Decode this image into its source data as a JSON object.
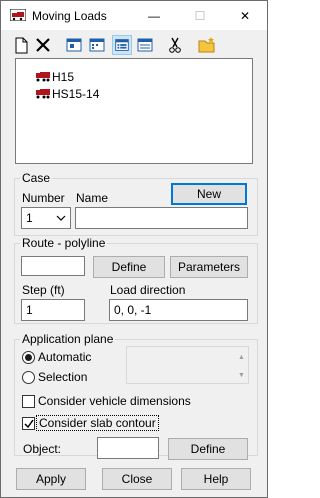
{
  "window": {
    "title": "Moving Loads"
  },
  "titlebar_buttons": {
    "minimize": "—",
    "maximize": "☐",
    "close": "✕"
  },
  "loads": [
    {
      "label": "H15"
    },
    {
      "label": "HS15-14"
    }
  ],
  "case": {
    "group_label": "Case",
    "number_label": "Number",
    "name_label": "Name",
    "new_button": "New",
    "number_value": "1",
    "name_value": ""
  },
  "route": {
    "group_label": "Route - polyline",
    "value": "",
    "define_button": "Define",
    "parameters_button": "Parameters",
    "step_label": "Step (ft)",
    "step_value": "1",
    "direction_label": "Load direction",
    "direction_value": "0, 0, -1"
  },
  "application": {
    "group_label": "Application plane",
    "automatic_label": "Automatic",
    "selection_label": "Selection",
    "selected": "automatic"
  },
  "options": {
    "vehicle_dims_label": "Consider vehicle dimensions",
    "vehicle_dims_checked": false,
    "slab_contour_label": "Consider slab contour",
    "slab_contour_checked": true
  },
  "object": {
    "label": "Object:",
    "value": "",
    "define_button": "Define"
  },
  "footer": {
    "apply": "Apply",
    "close": "Close",
    "help": "Help"
  },
  "icons": {
    "app": "moving-load-icon",
    "accent": "#0078d7",
    "vehicle_color": "#b0151b"
  }
}
